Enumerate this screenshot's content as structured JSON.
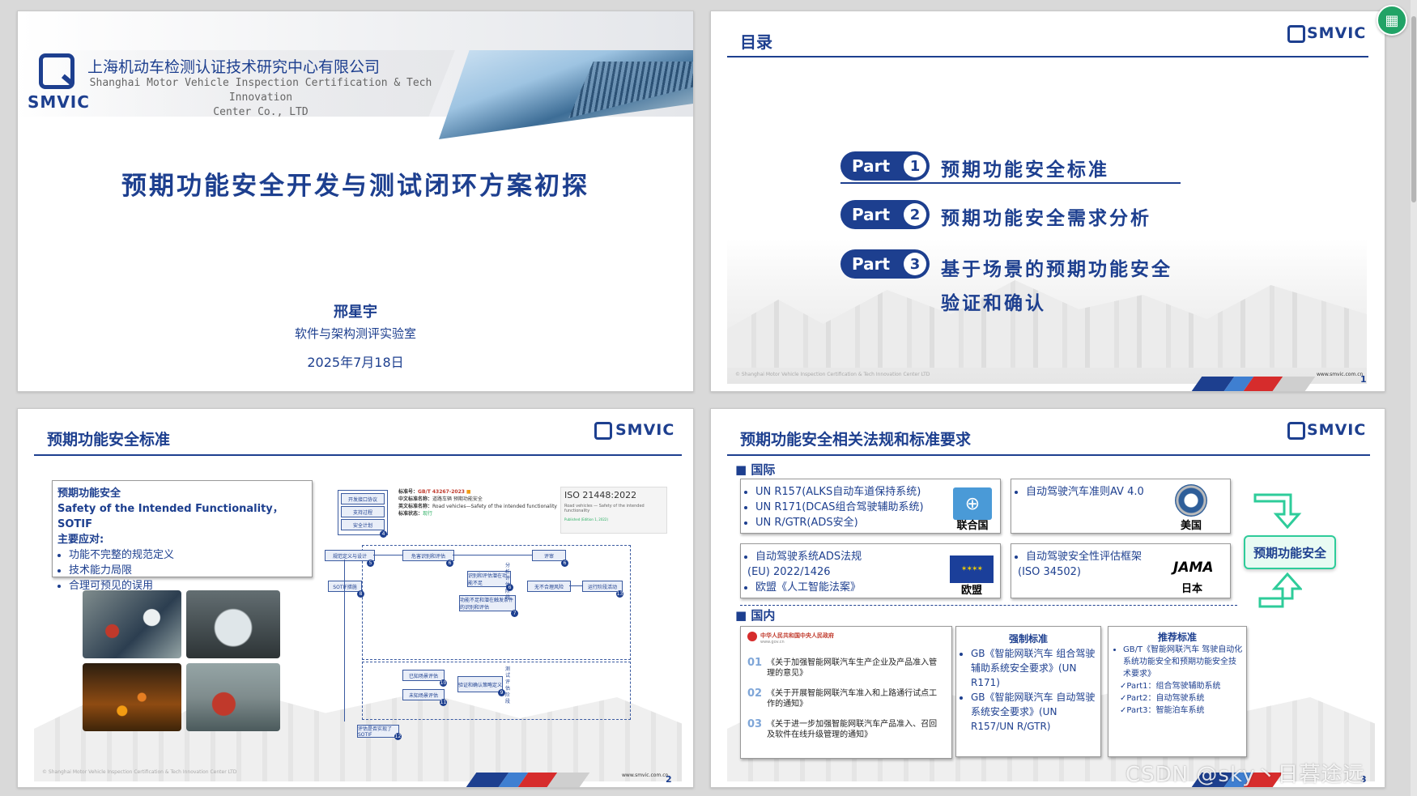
{
  "slide1": {
    "company_cn": "上海机动车检测认证技术研究中心有限公司",
    "company_en_1": "Shanghai Motor Vehicle Inspection Certification & Tech Innovation",
    "company_en_2": "Center Co., LTD",
    "logo_text": "SMVIC",
    "title": "预期功能安全开发与测试闭环方案初探",
    "author": "邢星宇",
    "dept": "软件与架构测评实验室",
    "date": "2025年7月18日"
  },
  "slide2": {
    "heading": "目录",
    "logo_text": "SMVIC",
    "part_label": "Part",
    "parts": [
      {
        "num": "1",
        "title": "预期功能安全标准"
      },
      {
        "num": "2",
        "title": "预期功能安全需求分析"
      },
      {
        "num": "3",
        "title": "基于场景的预期功能安全",
        "title2": "验证和确认"
      }
    ],
    "footer_left": "© Shanghai Motor Vehicle Inspection Certification & Tech Innovation Center LTD",
    "footer_url": "www.smvic.com.cn",
    "page": "1"
  },
  "slide3": {
    "heading": "预期功能安全标准",
    "logo_text": "SMVIC",
    "box_title": "预期功能安全",
    "box_sub": "Safety of the Intended Functionality，SOTIF",
    "box_resp": "主要应对:",
    "box_items": [
      "功能不完整的规范定义",
      "技术能力局限",
      "合理可预见的误用"
    ],
    "std_no_label": "标准号：",
    "std_no": "GB/T 43267-2023",
    "std_cn_label": "中文标准名称：",
    "std_cn": "道路车辆 预期功能安全",
    "std_en_label": "英文标准名称：",
    "std_en": "Road vehicles—Safety of the intended functionality",
    "std_state_label": "标准状态：",
    "std_state": "现行",
    "iso_title": "ISO 21448:2022",
    "iso_sub": "Road vehicles — Safety of the intended functionality",
    "iso_pub": "Published (Edition 1, 2022)",
    "flow_left": [
      "开发接口协议",
      "支持过程",
      "安全计划"
    ],
    "flow_nodes": [
      "规范定义与设计",
      "危害识别和评估",
      "SOTIF措施",
      "识别和评估潜在功能不足",
      "功能不足和潜在触发条件的识别和评估",
      "已知场景评估",
      "未知场景评估",
      "验证和确认策略定义",
      "评估是否实现了SOTIF",
      "评审",
      "无不合理风险",
      "运行阶段活动"
    ],
    "flow_side1": "分析评估阶段",
    "flow_side2": "测试评估阶段",
    "footer_left": "© Shanghai Motor Vehicle Inspection Certification & Tech Innovation Center LTD",
    "footer_url": "www.smvic.com.cn",
    "page": "2"
  },
  "slide4": {
    "heading": "预期功能安全相关法规和标准要求",
    "logo_text": "SMVIC",
    "intl_label": "国际",
    "un_items": [
      "UN R157(ALKS自动车道保持系统)",
      "UN R171(DCAS组合驾驶辅助系统)",
      "UN R/GTR(ADS安全)"
    ],
    "un_caption": "联合国",
    "us_items": [
      "自动驾驶汽车准则AV 4.0"
    ],
    "us_caption": "美国",
    "eu_items": [
      "自动驾驶系统ADS法规",
      "(EU) 2022/1426",
      "欧盟《人工智能法案》"
    ],
    "eu_caption": "欧盟",
    "jp_items": [
      "自动驾驶安全性评估框架",
      "(ISO 34502)"
    ],
    "jp_logo": "JAMA",
    "jp_caption": "日本",
    "domestic_label": "国内",
    "gov_header": "中华人民共和国中央人民政府",
    "gov_url": "www.gov.cn",
    "gov_items": [
      {
        "num": "01",
        "text": "《关于加强智能网联汽车生产企业及产品准入管理的意见》"
      },
      {
        "num": "02",
        "text": "《关于开展智能网联汽车准入和上路通行试点工作的通知》"
      },
      {
        "num": "03",
        "text": "《关于进一步加强智能网联汽车产品准入、召回及软件在线升级管理的通知》"
      }
    ],
    "mandatory_title": "强制标准",
    "mandatory_items": [
      "GB《智能网联汽车 组合驾驶辅助系统安全要求》(UN R171)",
      "GB《智能网联汽车 自动驾驶系统安全要求》(UN R157/UN R/GTR)"
    ],
    "recommended_title": "推荐标准",
    "recommended_main": "GB/T《智能网联汽车 驾驶自动化系统功能安全和预期功能安全技术要求》",
    "recommended_parts": [
      "Part1：组合驾驶辅助系统",
      "Part2：自动驾驶系统",
      "Part3：智能泊车系统"
    ],
    "sotif_badge": "预期功能安全",
    "page": "3"
  },
  "watermark": "CSDN @sky丶日暮途远",
  "sheets_icon": "sheets-icon"
}
